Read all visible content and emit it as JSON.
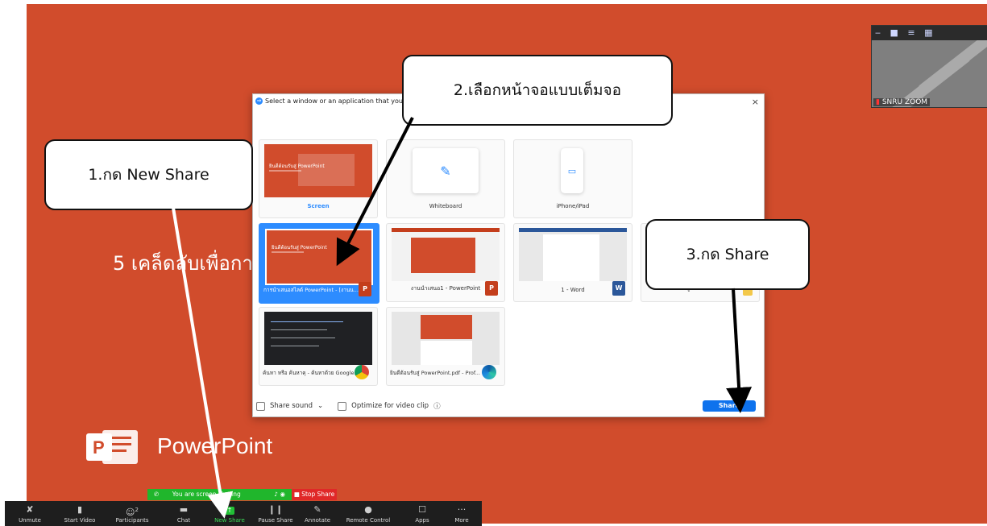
{
  "slide": {
    "title": "5 เคล็ดลับเพื่อการ",
    "app_name": "PowerPoint",
    "app_logo_letter": "P"
  },
  "video_thumb": {
    "controls": [
      "‒",
      "■",
      "≡",
      "▦"
    ],
    "name": "SNRU ZOOM"
  },
  "dialog": {
    "title": "Select a window or an application that you want t",
    "close": "×",
    "tiles": [
      {
        "label": "Screen",
        "preview_title": "ยินดีต้อนรับสู่ PowerPoint"
      },
      {
        "label": "Whiteboard"
      },
      {
        "label": "iPhone/iPad"
      },
      {
        "label": "การนำเสนอสไลด์ PowerPoint - [งานน...",
        "preview_title": "ยินดีต้อนรับสู่ PowerPoint",
        "icon": "P"
      },
      {
        "label": "งานนำเสนอ1 - PowerPoint",
        "icon": "P"
      },
      {
        "label": "1 - Word",
        "icon": "W"
      },
      {
        "label": "คู่มือ zoom"
      },
      {
        "label": "ค้นหา หรือ ค้นหาคุ - ค้นหาด้วย Google..."
      },
      {
        "label": "ยินดีต้อนรับสู่ PowerPoint.pdf - Prof..."
      }
    ],
    "share_sound": "Share sound",
    "optimize": "Optimize for video clip",
    "share_button": "Share"
  },
  "callouts": {
    "one": "1.กด New Share",
    "two": "2.เลือกหน้าจอแบบเต็มจอ",
    "three": "3.กด Share"
  },
  "sharing_bar": {
    "status": "You are screen sharing",
    "stop": "Stop Share"
  },
  "toolbar": {
    "items": [
      {
        "label": "Unmute",
        "icon": "✘"
      },
      {
        "label": "Start Video",
        "icon": "▮"
      },
      {
        "label": "Participants",
        "icon": "☺",
        "count": "2"
      },
      {
        "label": "Chat",
        "icon": "▬"
      },
      {
        "label": "New Share",
        "icon": "↑"
      },
      {
        "label": "Pause Share",
        "icon": "❙❙"
      },
      {
        "label": "Annotate",
        "icon": "✎"
      },
      {
        "label": "Remote Control",
        "icon": "●"
      },
      {
        "label": "Apps",
        "icon": "☐"
      },
      {
        "label": "More",
        "icon": "···"
      }
    ]
  }
}
